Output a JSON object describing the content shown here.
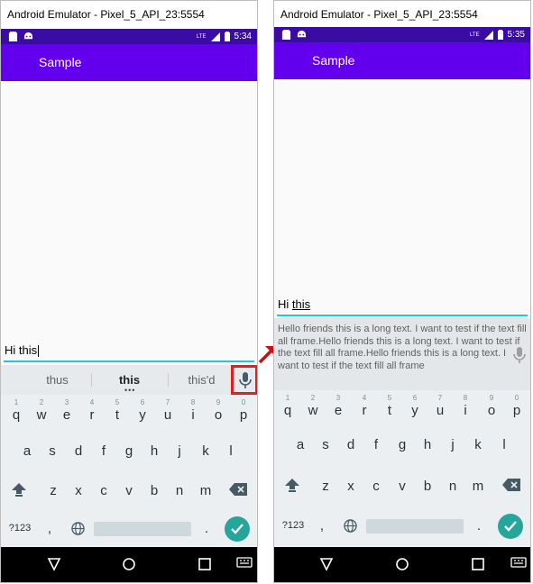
{
  "left": {
    "window_title": "Android Emulator - Pixel_5_API_23:5554",
    "status_time": "5:34",
    "status_network": "LTE",
    "app_title": "Sample",
    "entry": {
      "text": "Hi this"
    },
    "suggestions": [
      "thus",
      "this",
      "this'd"
    ],
    "keyboard": {
      "row1": [
        "q",
        "w",
        "e",
        "r",
        "t",
        "y",
        "u",
        "i",
        "o",
        "p"
      ],
      "row1_hints": [
        "1",
        "2",
        "3",
        "4",
        "5",
        "6",
        "7",
        "8",
        "9",
        "0"
      ],
      "row2": [
        "a",
        "s",
        "d",
        "f",
        "g",
        "h",
        "j",
        "k",
        "l"
      ],
      "row3": [
        "z",
        "x",
        "c",
        "v",
        "b",
        "n",
        "m"
      ],
      "symbols_key": "?123",
      "comma_key": ",",
      "period_key": "."
    }
  },
  "right": {
    "window_title": "Android Emulator - Pixel_5_API_23:5554",
    "status_time": "5:35",
    "status_network": "LTE",
    "app_title": "Sample",
    "entry": {
      "prefix": "Hi ",
      "underlined": "this"
    },
    "overlay_text": "Hello friends this is a long text. I want to test if the text fill all frame.Hello friends this is a long text. I want to test if the text fill all frame.Hello friends this is a long text. I want to test if the text fill all frame",
    "keyboard": {
      "row1": [
        "q",
        "w",
        "e",
        "r",
        "t",
        "y",
        "u",
        "i",
        "o",
        "p"
      ],
      "row1_hints": [
        "1",
        "2",
        "3",
        "4",
        "5",
        "6",
        "7",
        "8",
        "9",
        "0"
      ],
      "row2": [
        "a",
        "s",
        "d",
        "f",
        "g",
        "h",
        "j",
        "k",
        "l"
      ],
      "row3": [
        "z",
        "x",
        "c",
        "v",
        "b",
        "n",
        "m"
      ],
      "symbols_key": "?123",
      "comma_key": ",",
      "period_key": "."
    }
  },
  "colors": {
    "status_bar": "#3a0ca3",
    "app_bar": "#6200ee",
    "entry_underline": "#26c6da",
    "enter_key": "#26a69a",
    "highlight_box": "#e02020"
  },
  "icons": {
    "status_left": [
      "sd-card-icon",
      "android-icon"
    ],
    "status_right": [
      "signal-icon",
      "battery-icon"
    ],
    "keyboard": [
      "mic-icon",
      "shift-icon",
      "backspace-icon",
      "globe-icon",
      "checkmark-icon"
    ],
    "nav": [
      "back-icon",
      "home-icon",
      "recents-icon",
      "keyboard-icon"
    ],
    "annotation": [
      "red-arrow-icon"
    ]
  }
}
